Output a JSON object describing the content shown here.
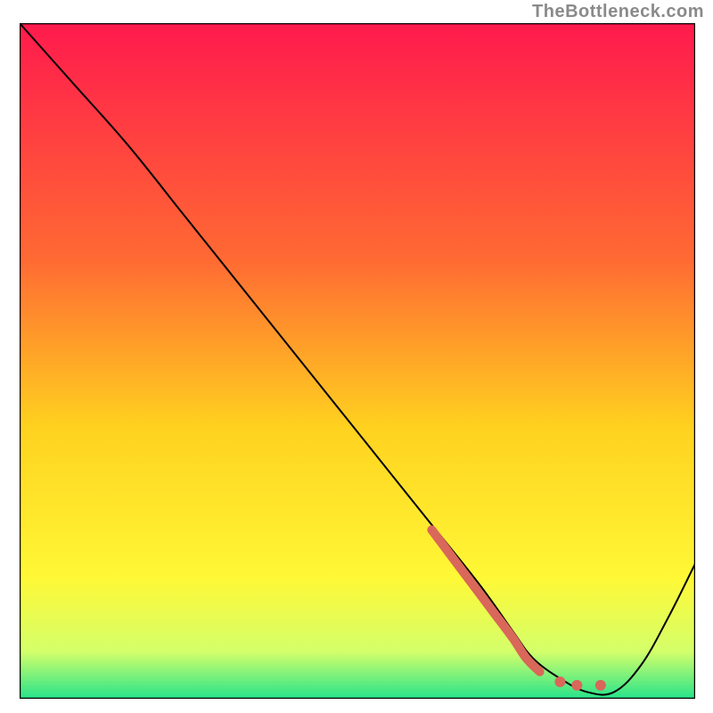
{
  "watermark": "TheBottleneck.com",
  "chart_data": {
    "type": "line",
    "title": "",
    "xlabel": "",
    "ylabel": "",
    "xlim": [
      0,
      100
    ],
    "ylim": [
      0,
      100
    ],
    "grid": false,
    "legend": false,
    "background_gradient": {
      "top": "#ff1a4d",
      "mid1": "#ff6a33",
      "mid2": "#ffd21f",
      "mid3": "#fff836",
      "mid4": "#d4ff6a",
      "bottom": "#27e38b"
    },
    "series": [
      {
        "name": "main-curve",
        "color": "#000000",
        "stroke_width": 2,
        "x": [
          0,
          8,
          16,
          24,
          28,
          36,
          44,
          52,
          60,
          68,
          73,
          76,
          80,
          84,
          88,
          92,
          96,
          100
        ],
        "y": [
          100,
          91,
          82,
          72,
          67,
          57,
          47,
          37,
          27,
          17,
          10,
          6,
          3,
          1,
          1,
          5,
          12,
          20
        ]
      },
      {
        "name": "highlight-segment",
        "color": "#d9675a",
        "stroke_width": 10,
        "linecap": "round",
        "x": [
          61,
          64,
          67,
          70,
          73,
          75,
          77
        ],
        "y": [
          25,
          21,
          17,
          13,
          9,
          6,
          4
        ]
      },
      {
        "name": "highlight-dots",
        "color": "#d9675a",
        "type": "scatter",
        "marker_radius": 6,
        "x": [
          80,
          82.5,
          86
        ],
        "y": [
          2.5,
          2.0,
          2.0
        ]
      }
    ]
  }
}
